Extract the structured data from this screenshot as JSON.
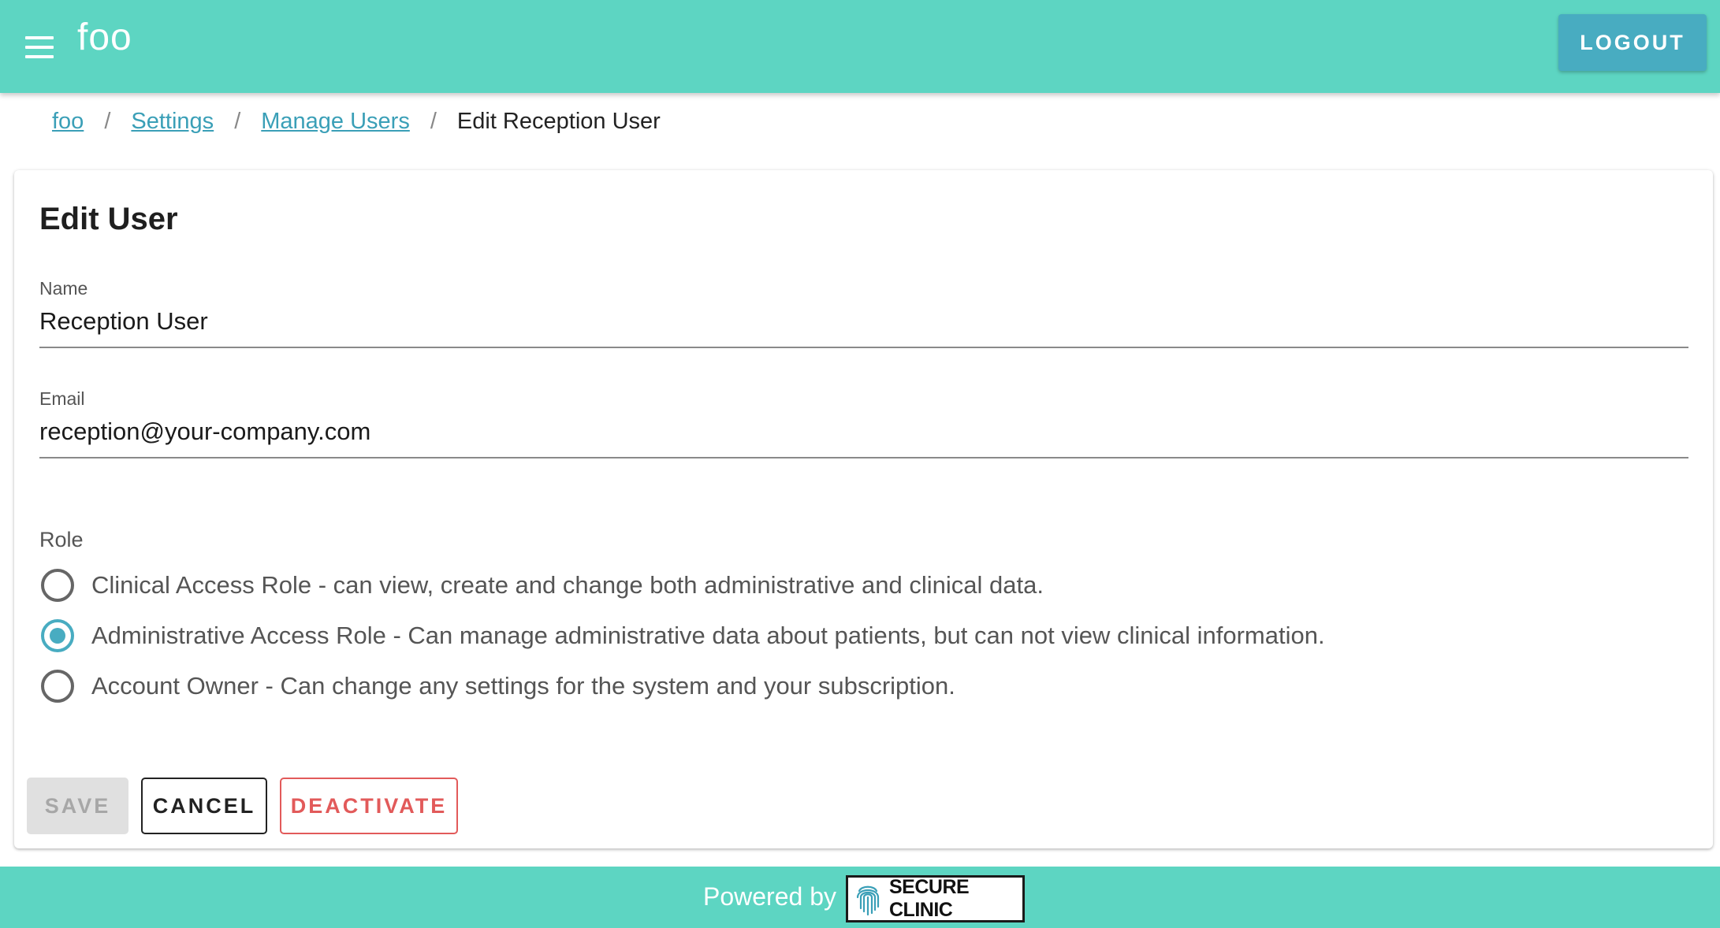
{
  "header": {
    "menu_icon": "hamburger-menu-icon",
    "app_title": "foo",
    "logout_label": "LOGOUT"
  },
  "breadcrumb": {
    "items": [
      {
        "label": "foo"
      },
      {
        "label": "Settings"
      },
      {
        "label": "Manage Users"
      }
    ],
    "current": "Edit Reception User",
    "separator": "/"
  },
  "form": {
    "title": "Edit User",
    "name": {
      "label": "Name",
      "value": "Reception User"
    },
    "email": {
      "label": "Email",
      "value": "reception@your-company.com"
    },
    "role": {
      "label": "Role",
      "selected": "administrative",
      "options": [
        {
          "id": "clinical",
          "label": "Clinical Access Role - can view, create and change both administrative and clinical data.",
          "checked": false
        },
        {
          "id": "administrative",
          "label": "Administrative Access Role - Can manage administrative data about patients, but can not view clinical information.",
          "checked": true
        },
        {
          "id": "owner",
          "label": "Account Owner - Can change any settings for the system and your subscription.",
          "checked": false
        }
      ]
    },
    "actions": {
      "save_label": "SAVE",
      "save_disabled": true,
      "cancel_label": "CANCEL",
      "deactivate_label": "DEACTIVATE"
    }
  },
  "footer": {
    "powered_by": "Powered by",
    "brand_name": "SECURE CLINIC",
    "brand_icon": "fingerprint-icon"
  },
  "colors": {
    "primary": "#5dd5c2",
    "accent": "#48acc1",
    "danger": "#e25a5a",
    "link": "#3a9fb7"
  }
}
